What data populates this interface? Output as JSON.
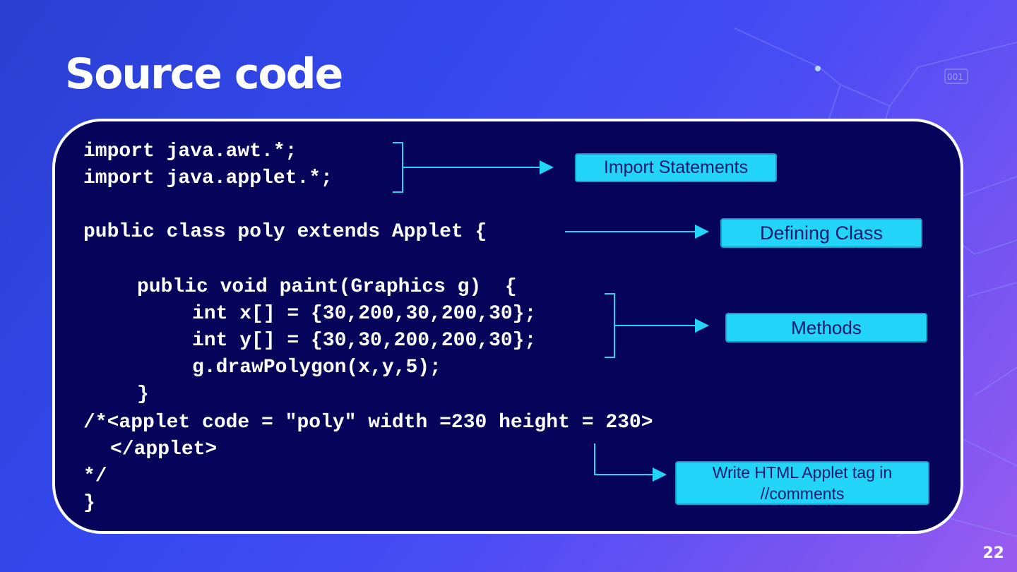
{
  "slide": {
    "title": "Source code",
    "page_number": "22",
    "decor_badge": "001"
  },
  "code": {
    "lines": [
      "import java.awt.*;",
      "import java.applet.*;",
      "public class poly extends Applet {",
      "public void paint(Graphics g)  {",
      "int x[] = {30,200,30,200,30};",
      "int y[] = {30,30,200,200,30};",
      "g.drawPolygon(x,y,5);",
      "}",
      "/*<applet code = \"poly\" width =230 height = 230>",
      "</applet>",
      "*/",
      "}"
    ]
  },
  "labels": {
    "imports": "Import Statements",
    "class": "Defining Class",
    "methods": "Methods",
    "html_line1": "Write HTML Applet tag in",
    "html_line2": "//comments"
  },
  "colors": {
    "panel_bg": "#05035a",
    "label_bg": "#22d4f8",
    "arrow": "#22d4f8",
    "label_text": "#0a1a6e"
  }
}
